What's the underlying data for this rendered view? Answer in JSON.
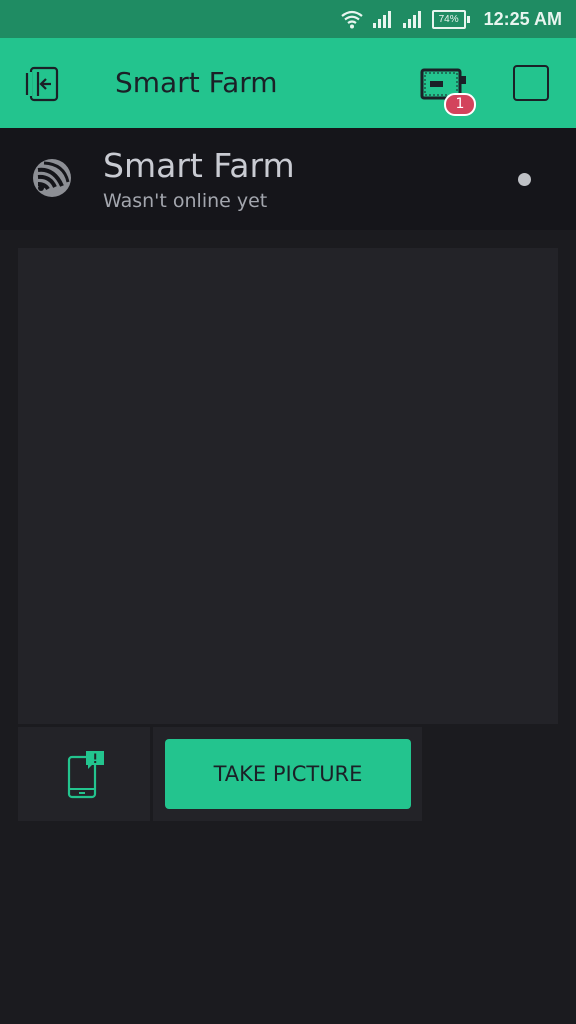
{
  "status_bar": {
    "time": "12:25 AM",
    "battery_percent": "74%",
    "icons": [
      "wifi-icon",
      "signal-icon",
      "signal-icon",
      "battery-icon"
    ]
  },
  "app_bar": {
    "title": "Smart Farm",
    "back_icon": "exit-project-icon",
    "device_icon": "device-icon",
    "device_badge": "1",
    "square_icon": "square-icon"
  },
  "device": {
    "name": "Smart Farm",
    "status": "Wasn't online yet",
    "logo_icon": "espressif-logo-icon"
  },
  "widgets": {
    "notification_icon": "phone-notification-icon",
    "take_picture_label": "TAKE PICTURE"
  },
  "colors": {
    "accent": "#23c48e",
    "status_bar": "#1f8c63",
    "background": "#1b1b1f",
    "tile": "#232328",
    "badge": "#d3435c"
  }
}
